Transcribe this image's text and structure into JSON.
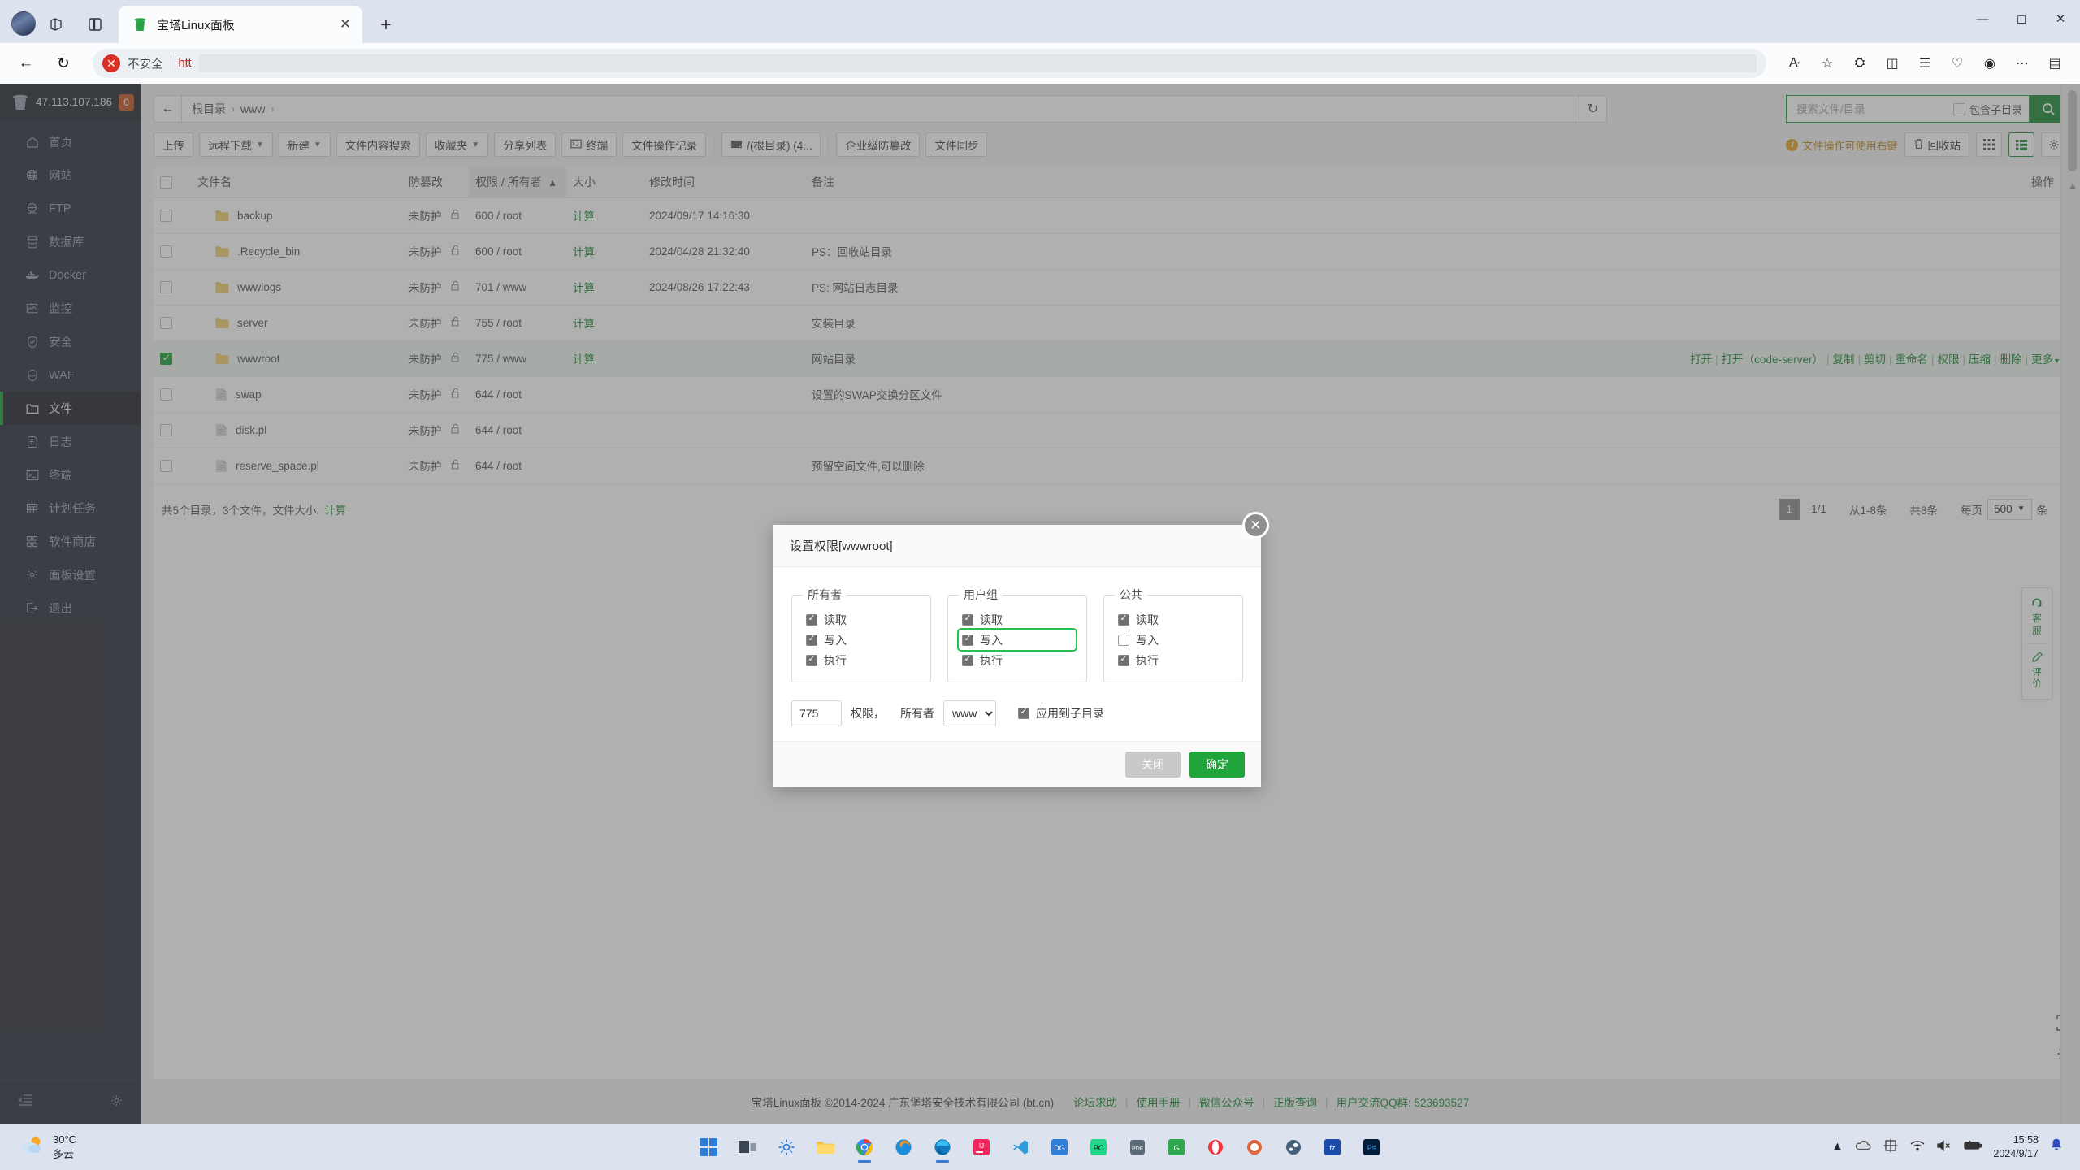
{
  "browser": {
    "tab_title": "宝塔Linux面板",
    "security_label": "不安全",
    "url_visible": "htt",
    "new_tab_label": "+",
    "close_tab_label": "✕"
  },
  "sidebar": {
    "ip": "47.113.107.186",
    "badge": "0",
    "items": [
      {
        "label": "首页",
        "icon": "home-icon"
      },
      {
        "label": "网站",
        "icon": "globe-icon"
      },
      {
        "label": "FTP",
        "icon": "ftp-icon"
      },
      {
        "label": "数据库",
        "icon": "database-icon"
      },
      {
        "label": "Docker",
        "icon": "docker-icon"
      },
      {
        "label": "监控",
        "icon": "monitor-icon"
      },
      {
        "label": "安全",
        "icon": "shield-icon"
      },
      {
        "label": "WAF",
        "icon": "waf-icon"
      },
      {
        "label": "文件",
        "icon": "folder-icon"
      },
      {
        "label": "日志",
        "icon": "log-icon"
      },
      {
        "label": "终端",
        "icon": "terminal-icon"
      },
      {
        "label": "计划任务",
        "icon": "calendar-icon"
      },
      {
        "label": "软件商店",
        "icon": "apps-icon"
      },
      {
        "label": "面板设置",
        "icon": "gear-icon"
      },
      {
        "label": "退出",
        "icon": "logout-icon"
      }
    ],
    "active_index": 8
  },
  "path": {
    "crumb_root": "根目录",
    "crumb_www": "www",
    "separator": "›"
  },
  "search": {
    "placeholder": "搜索文件/目录",
    "value": "",
    "include_subdir_label": "包含子目录"
  },
  "toolbar": {
    "upload": "上传",
    "remote_download": "远程下载",
    "new": "新建",
    "content_search": "文件内容搜索",
    "favorites": "收藏夹",
    "share_list": "分享列表",
    "terminal": "终端",
    "file_ops_log": "文件操作记录",
    "disk": "/(根目录) (4...",
    "enterprise_antitamper": "企业级防篡改",
    "file_sync": "文件同步",
    "tip": "文件操作可使用右键",
    "recycle_bin": "回收站"
  },
  "table": {
    "headers": {
      "filename": "文件名",
      "antitamper": "防篡改",
      "perm_owner": "权限 / 所有者",
      "size": "大小",
      "mtime": "修改时间",
      "remark": "备注",
      "ops": "操作"
    },
    "sort_indicator": "︿",
    "rows": [
      {
        "name": "backup",
        "type": "folder",
        "antitamper": "未防护",
        "perm": "600 / root",
        "size": "计算",
        "mtime": "2024/09/17 14:16:30",
        "remark": "",
        "selected": false
      },
      {
        "name": ".Recycle_bin",
        "type": "folder",
        "antitamper": "未防护",
        "perm": "600 / root",
        "size": "计算",
        "mtime": "2024/04/28 21:32:40",
        "remark": "PS：回收站目录",
        "selected": false
      },
      {
        "name": "wwwlogs",
        "type": "folder",
        "antitamper": "未防护",
        "perm": "701 / www",
        "size": "计算",
        "mtime": "2024/08/26 17:22:43",
        "remark": "PS: 网站日志目录",
        "selected": false
      },
      {
        "name": "server",
        "type": "folder",
        "antitamper": "未防护",
        "perm": "755 / root",
        "size": "计算",
        "mtime": "",
        "remark": "安装目录",
        "selected": false
      },
      {
        "name": "wwwroot",
        "type": "folder",
        "antitamper": "未防护",
        "perm": "775 / www",
        "size": "计算",
        "mtime": "",
        "remark": "网站目录",
        "selected": true
      },
      {
        "name": "swap",
        "type": "file",
        "antitamper": "未防护",
        "perm": "644 / root",
        "size": "",
        "mtime": "",
        "remark": "设置的SWAP交换分区文件",
        "selected": false
      },
      {
        "name": "disk.pl",
        "type": "file",
        "antitamper": "未防护",
        "perm": "644 / root",
        "size": "",
        "mtime": "",
        "remark": "",
        "selected": false
      },
      {
        "name": "reserve_space.pl",
        "type": "file",
        "antitamper": "未防护",
        "perm": "644 / root",
        "size": "",
        "mtime": "",
        "remark": "预留空间文件,可以删除",
        "selected": false
      }
    ],
    "row_actions": [
      "打开",
      "打开（code-server）",
      "复制",
      "剪切",
      "重命名",
      "权限",
      "压缩",
      "删除",
      "更多"
    ]
  },
  "status": {
    "summary": "共5个目录，3个文件，文件大小:",
    "summary_link": "计算",
    "page_current": "1",
    "page_of": "1/1",
    "range": "从1-8条",
    "total": "共8条",
    "per_page_label": "每页",
    "per_page_value": "500",
    "per_page_unit": "条"
  },
  "footer": {
    "copyright": "宝塔Linux面板 ©2014-2024 广东堡塔安全技术有限公司 (bt.cn)",
    "links": [
      "论坛求助",
      "使用手册",
      "微信公众号",
      "正版查询",
      "用户交流QQ群: 523693527"
    ]
  },
  "kefu": {
    "service_line1": "客",
    "service_line2": "服",
    "rate_line1": "评",
    "rate_line2": "价"
  },
  "modal": {
    "title": "设置权限[wwwroot]",
    "groups": [
      {
        "name": "所有者",
        "options": [
          {
            "label": "读取",
            "checked": true,
            "highlight": false
          },
          {
            "label": "写入",
            "checked": true,
            "highlight": false
          },
          {
            "label": "执行",
            "checked": true,
            "highlight": false
          }
        ]
      },
      {
        "name": "用户组",
        "options": [
          {
            "label": "读取",
            "checked": true,
            "highlight": false
          },
          {
            "label": "写入",
            "checked": true,
            "highlight": true
          },
          {
            "label": "执行",
            "checked": true,
            "highlight": false
          }
        ]
      },
      {
        "name": "公共",
        "options": [
          {
            "label": "读取",
            "checked": true,
            "highlight": false
          },
          {
            "label": "写入",
            "checked": false,
            "highlight": false
          },
          {
            "label": "执行",
            "checked": true,
            "highlight": false
          }
        ]
      }
    ],
    "perm_value": "775",
    "perm_label": "权限，",
    "owner_label": "所有者",
    "owner_value": "www",
    "apply_subdir_label": "应用到子目录",
    "apply_subdir_checked": true,
    "close_btn": "关闭",
    "confirm_btn": "确定"
  },
  "taskbar": {
    "weather_temp": "30°C",
    "weather_desc": "多云",
    "time": "15:58",
    "date": "2024/9/17",
    "ime": "中"
  },
  "colors": {
    "accent_green": "#20a53a",
    "sidebar_bg": "#2b303b",
    "badge_orange": "#c0562a",
    "tip_orange": "#c08a1e"
  }
}
